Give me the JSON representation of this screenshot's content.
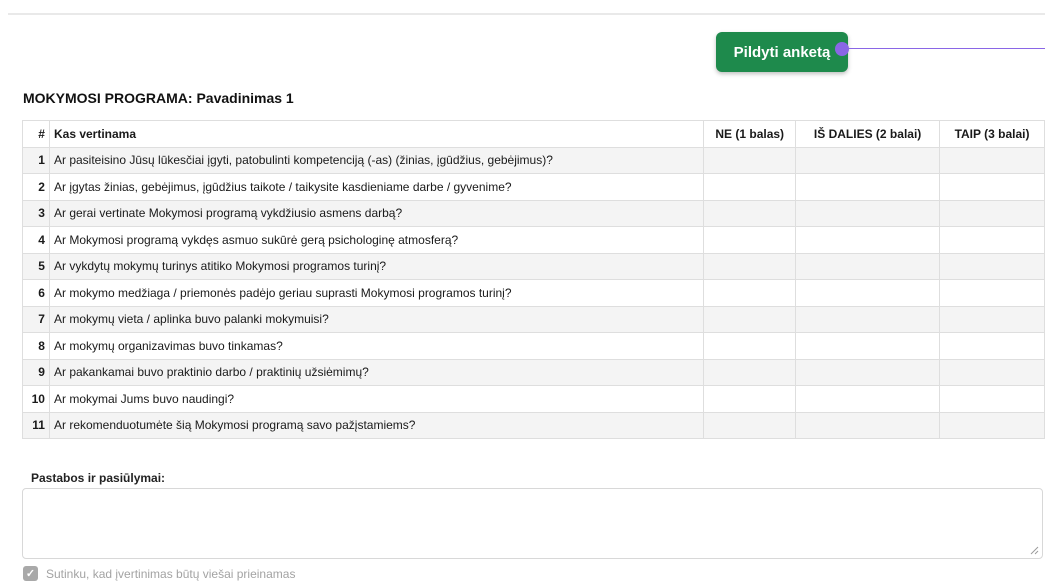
{
  "action_button": {
    "label": "Pildyti anketą"
  },
  "section": {
    "title": "MOKYMOSI PROGRAMA: Pavadinimas 1"
  },
  "table": {
    "headers": {
      "num": "#",
      "question": "Kas vertinama",
      "ne": "NE (1 balas)",
      "is_dalies": "IŠ DALIES (2 balai)",
      "taip": "TAIP (3 balai)"
    },
    "rows": [
      {
        "num": "1",
        "question": "Ar pasiteisino Jūsų lūkesčiai įgyti, patobulinti kompetenciją (-as) (žinias, įgūdžius, gebėjimus)?"
      },
      {
        "num": "2",
        "question": "Ar įgytas žinias, gebėjimus, įgūdžius taikote / taikysite kasdieniame darbe / gyvenime?"
      },
      {
        "num": "3",
        "question": "Ar gerai vertinate Mokymosi programą vykdžiusio asmens darbą?"
      },
      {
        "num": "4",
        "question": "Ar Mokymosi programą vykdęs asmuo sukūrė gerą psichologinę atmosferą?"
      },
      {
        "num": "5",
        "question": "Ar vykdytų mokymų turinys atitiko Mokymosi programos turinį?"
      },
      {
        "num": "6",
        "question": "Ar mokymo medžiaga / priemonės padėjo geriau suprasti Mokymosi programos turinį?"
      },
      {
        "num": "7",
        "question": "Ar mokymų vieta / aplinka buvo palanki mokymuisi?"
      },
      {
        "num": "8",
        "question": "Ar mokymų organizavimas buvo tinkamas?"
      },
      {
        "num": "9",
        "question": "Ar pakankamai buvo praktinio darbo / praktinių užsiėmimų?"
      },
      {
        "num": "10",
        "question": "Ar mokymai Jums buvo naudingi?"
      },
      {
        "num": "11",
        "question": "Ar rekomenduotumėte šią Mokymosi programą savo pažįstamiems?"
      }
    ]
  },
  "comments": {
    "label": "Pastabos ir pasiūlymai:",
    "value": ""
  },
  "consent": {
    "label": "Sutinku, kad įvertinimas būtų viešai prieinamas",
    "checked": true,
    "check_icon": "checkmark-icon"
  },
  "colors": {
    "button": "#1e8a4c",
    "pointer": "#8a66e6",
    "checkbox": "#a9a9a9"
  }
}
